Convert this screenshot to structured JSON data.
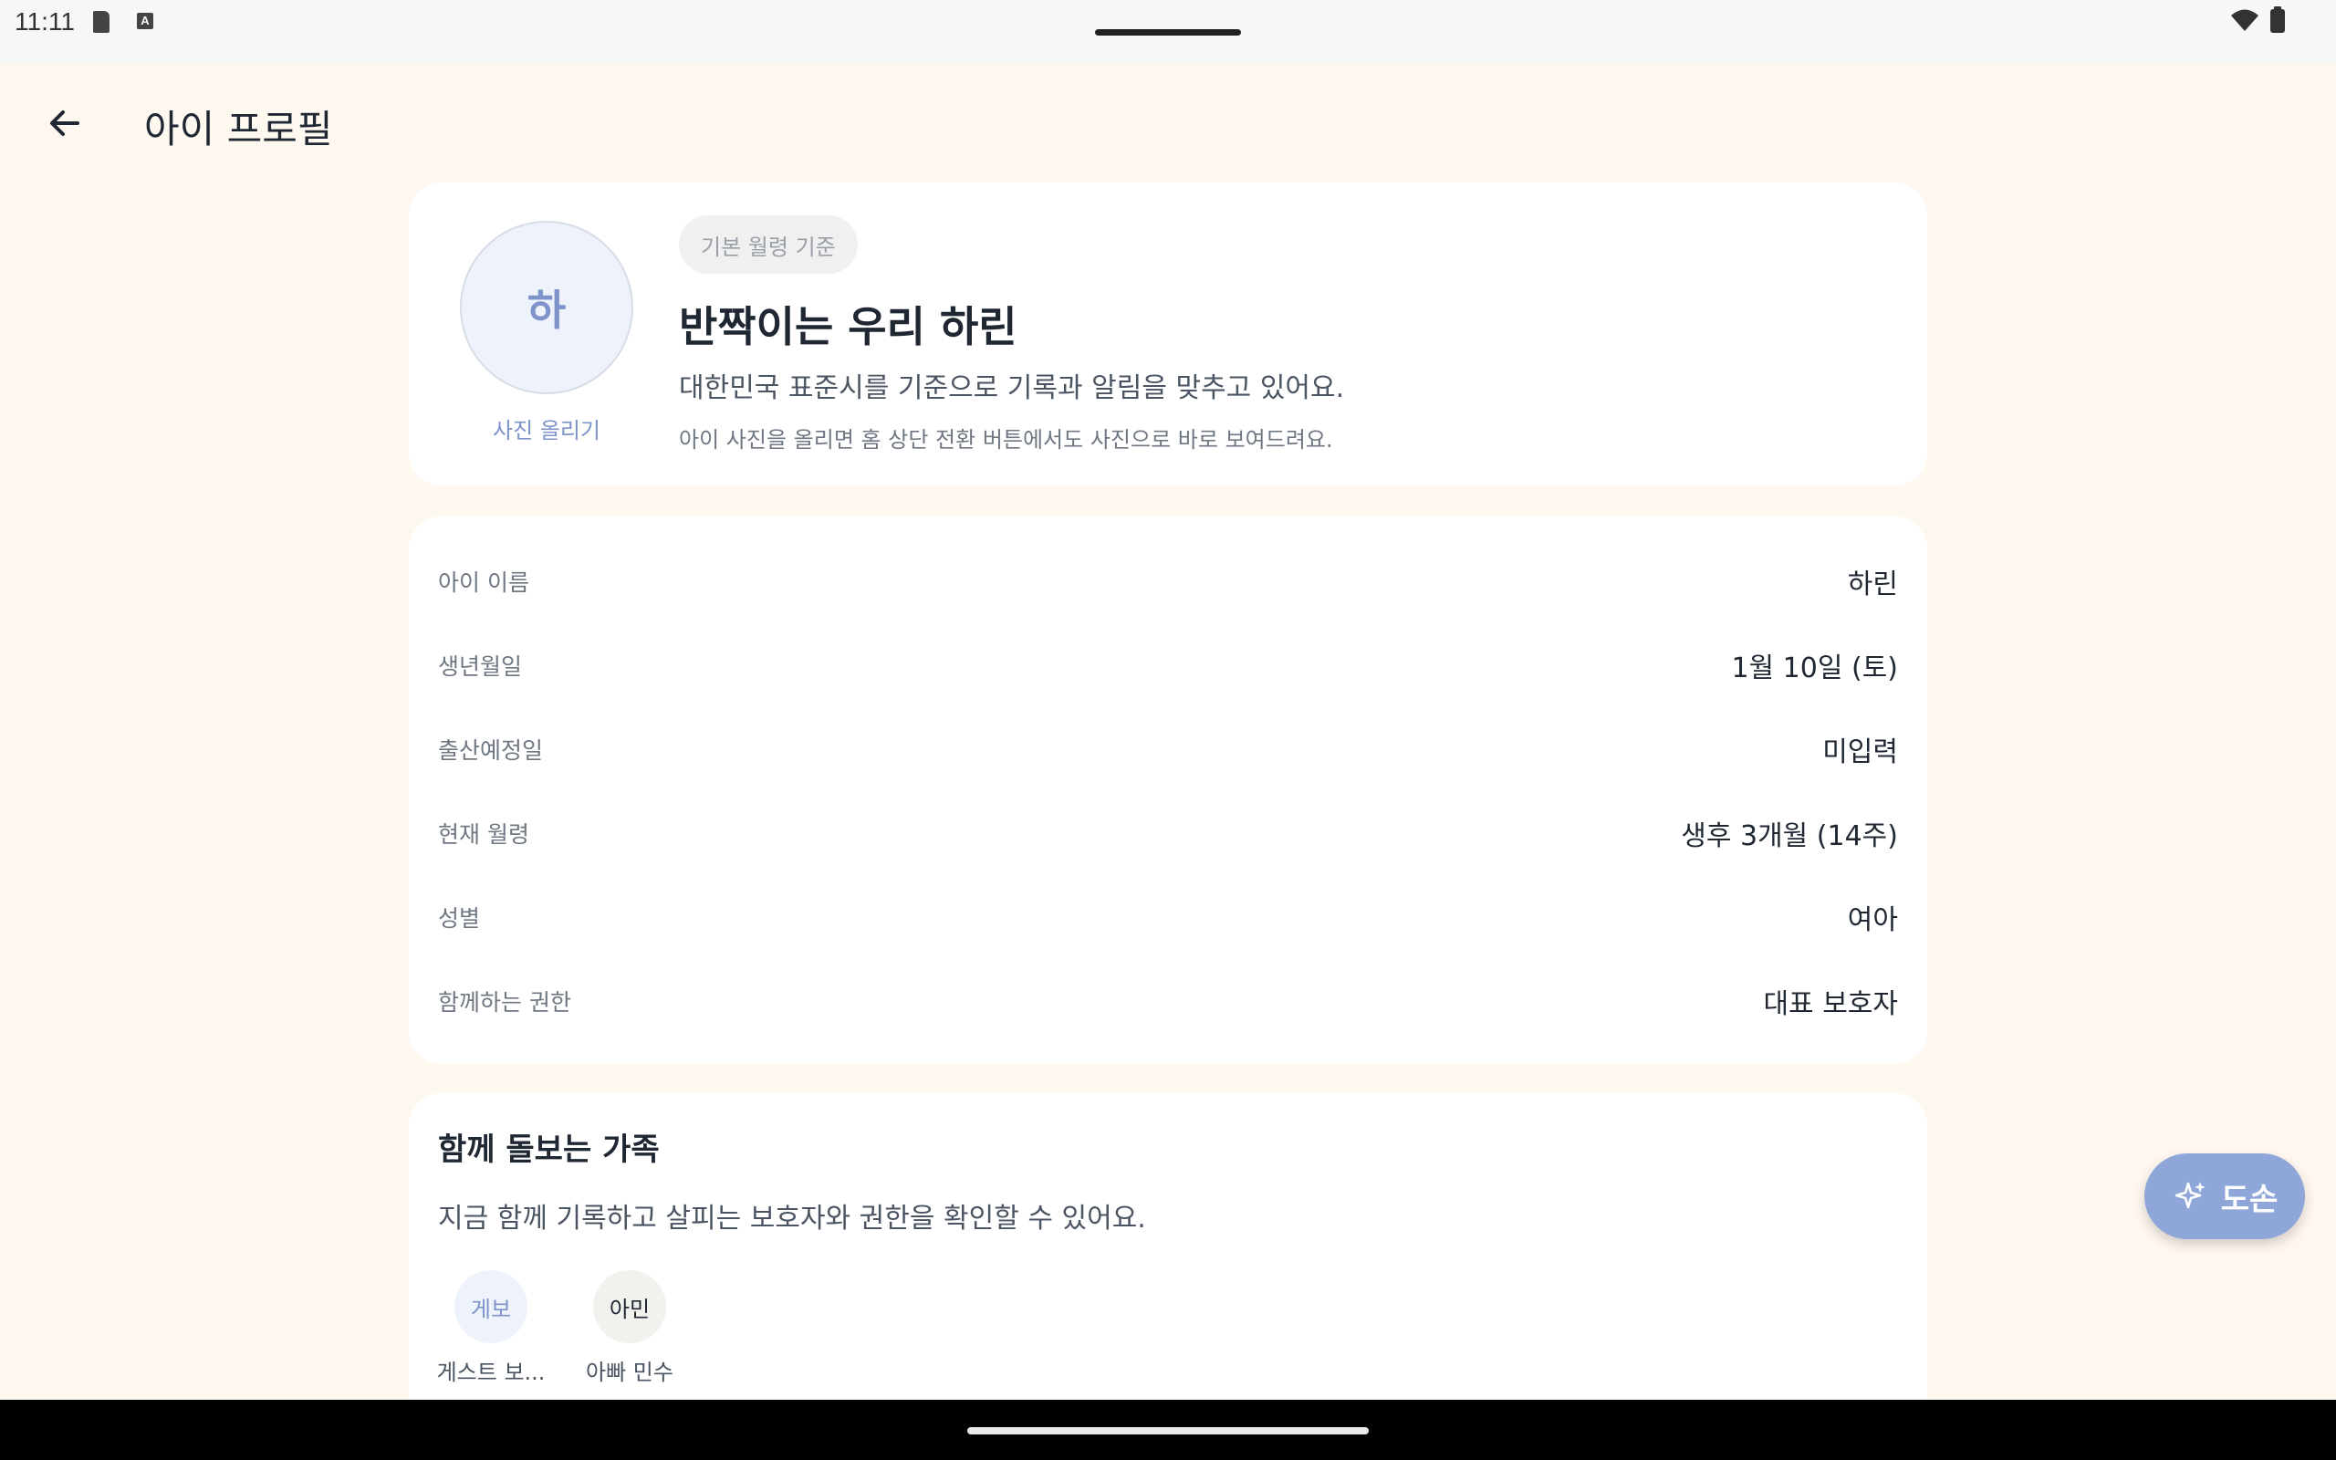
{
  "status_bar": {
    "time": "11:11",
    "icons": [
      "sd-card-icon",
      "a-notification-icon",
      "wifi-icon",
      "battery-icon"
    ]
  },
  "header": {
    "title": "아이 프로필",
    "back_icon": "arrow-left-icon"
  },
  "profile": {
    "avatar_initial": "하",
    "upload_label": "사진 올리기",
    "age_basis_chip": "기본 월령 기준",
    "title": "반짝이는 우리 하린",
    "description": "대한민국 표준시를 기준으로 기록과 알림을 맞추고 있어요.",
    "note": "아이 사진을 올리면 홈 상단 전환 버튼에서도 사진으로 바로 보여드려요."
  },
  "details": {
    "rows": [
      {
        "label": "아이 이름",
        "value": "하린"
      },
      {
        "label": "생년월일",
        "value": "1월 10일 (토)"
      },
      {
        "label": "출산예정일",
        "value": "미입력"
      },
      {
        "label": "현재 월령",
        "value": "생후 3개월 (14주)"
      },
      {
        "label": "성별",
        "value": "여아"
      },
      {
        "label": "함께하는 권한",
        "value": "대표 보호자"
      }
    ]
  },
  "family": {
    "title": "함께 돌보는 가족",
    "description": "지금 함께 기록하고 살피는 보호자와 권한을 확인할 수 있어요.",
    "members": [
      {
        "initial": "게보",
        "name": "게스트 보...",
        "bg": "#eef2fb",
        "fg": "#7d93c9"
      },
      {
        "initial": "아민",
        "name": "아빠 민수",
        "bg": "#f1f1ee",
        "fg": "#1f2733"
      }
    ]
  },
  "fab": {
    "label": "도손",
    "icon": "sparkles-icon",
    "color": "#8fa6d9"
  },
  "colors": {
    "background": "#fff8f1",
    "card": "#ffffff",
    "accent": "#7d93c9",
    "text": "#1f2733"
  }
}
